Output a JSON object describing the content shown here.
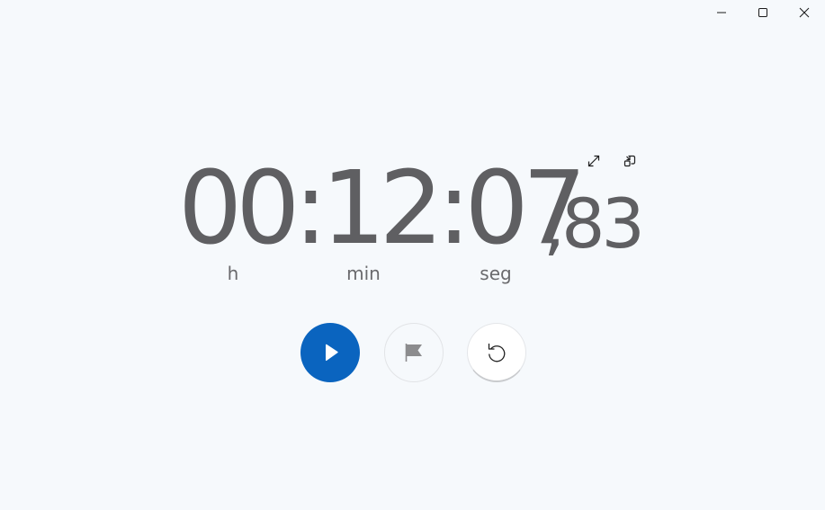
{
  "window": {
    "caption": {
      "minimize": "minimize-icon",
      "maximize": "maximize-icon",
      "close": "close-icon"
    }
  },
  "stopwatch": {
    "time_main": "00:12:07",
    "time_fraction": ",83",
    "units": {
      "hours": "h",
      "minutes": "min",
      "seconds": "seg"
    }
  },
  "icons": {
    "expand": "expand-icon",
    "compact_overlay": "keep-on-top-icon",
    "play": "play-icon",
    "lap": "flag-icon",
    "reset": "reset-icon"
  },
  "colors": {
    "background": "#f6f9fc",
    "accent": "#0a64bf",
    "digits": "#5f5f62"
  }
}
